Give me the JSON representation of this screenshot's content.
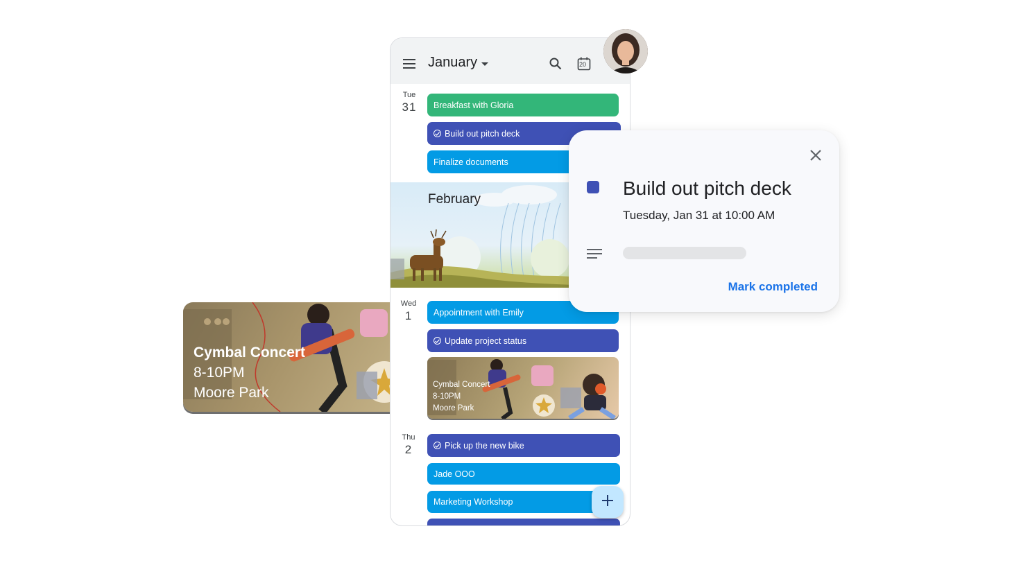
{
  "concert_card": {
    "title": "Cymbal Concert",
    "time": "8-10PM",
    "location": "Moore Park"
  },
  "appbar": {
    "month": "January",
    "today_badge": "20",
    "icons": [
      "menu-icon",
      "dropdown-arrow-icon",
      "search-icon",
      "today-calendar-icon"
    ]
  },
  "days": [
    {
      "dow": "Tue",
      "num": "31",
      "events": [
        {
          "label": "Breakfast with Gloria",
          "color": "#33b679",
          "task": false
        },
        {
          "label": "Build out pitch deck",
          "color": "#3f51b5",
          "task": true
        },
        {
          "label": "Finalize documents",
          "color": "#039be5",
          "task": false
        }
      ]
    },
    {
      "dow": "Wed",
      "num": "1",
      "events": [
        {
          "label": "Appointment with Emily",
          "color": "#039be5",
          "task": false
        },
        {
          "label": "Update project status",
          "color": "#3f51b5",
          "task": true
        }
      ],
      "concert": {
        "title": "Cymbal Concert",
        "time": "8-10PM",
        "location": "Moore Park"
      }
    },
    {
      "dow": "Thu",
      "num": "2",
      "events": [
        {
          "label": "Pick up the new bike",
          "color": "#3f51b5",
          "task": true
        },
        {
          "label": "Jade OOO",
          "color": "#039be5",
          "task": false
        },
        {
          "label": "Marketing Workshop",
          "color": "#039be5",
          "task": false
        }
      ]
    }
  ],
  "month_banner": "February",
  "fab_icon": "plus-icon",
  "detail": {
    "title": "Build out pitch deck",
    "when": "Tuesday, Jan 31 at 10:00 AM",
    "action": "Mark completed",
    "color": "#3f51b5",
    "icons": [
      "close-icon",
      "description-icon"
    ]
  }
}
